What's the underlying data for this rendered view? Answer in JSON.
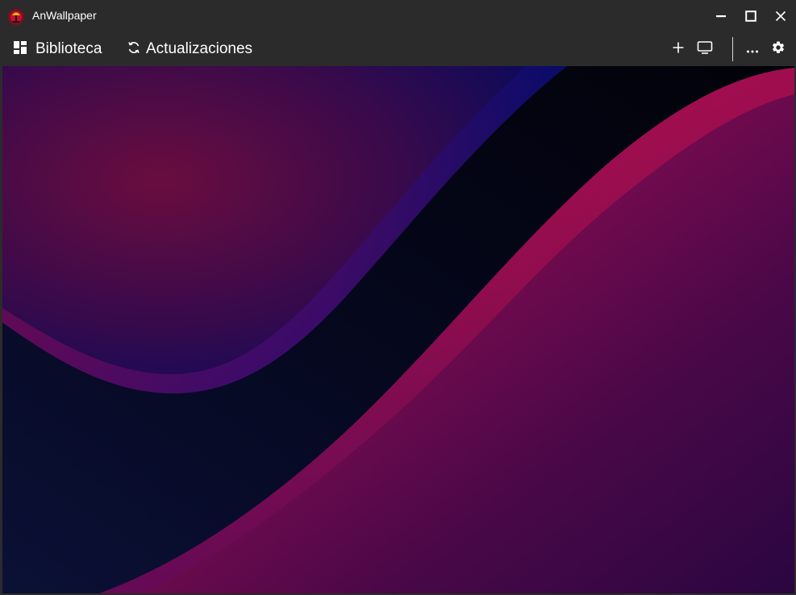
{
  "window": {
    "title": "AnWallpaper",
    "controls": {
      "minimize": "minimize-icon",
      "maximize": "maximize-icon",
      "close": "close-icon"
    }
  },
  "toolbar": {
    "library_label": "Biblioteca",
    "updates_label": "Actualizaciones",
    "icons": [
      "grid-icon",
      "refresh-icon",
      "plus-icon",
      "monitor-icon",
      "more-icon",
      "gear-icon"
    ]
  },
  "colors": {
    "chrome": "#2b2b2b",
    "wallpaper_dark": "#05081a",
    "wallpaper_magenta": "#c0104f",
    "wallpaper_purple": "#3a0844",
    "wallpaper_blue": "#0a0e6e"
  }
}
